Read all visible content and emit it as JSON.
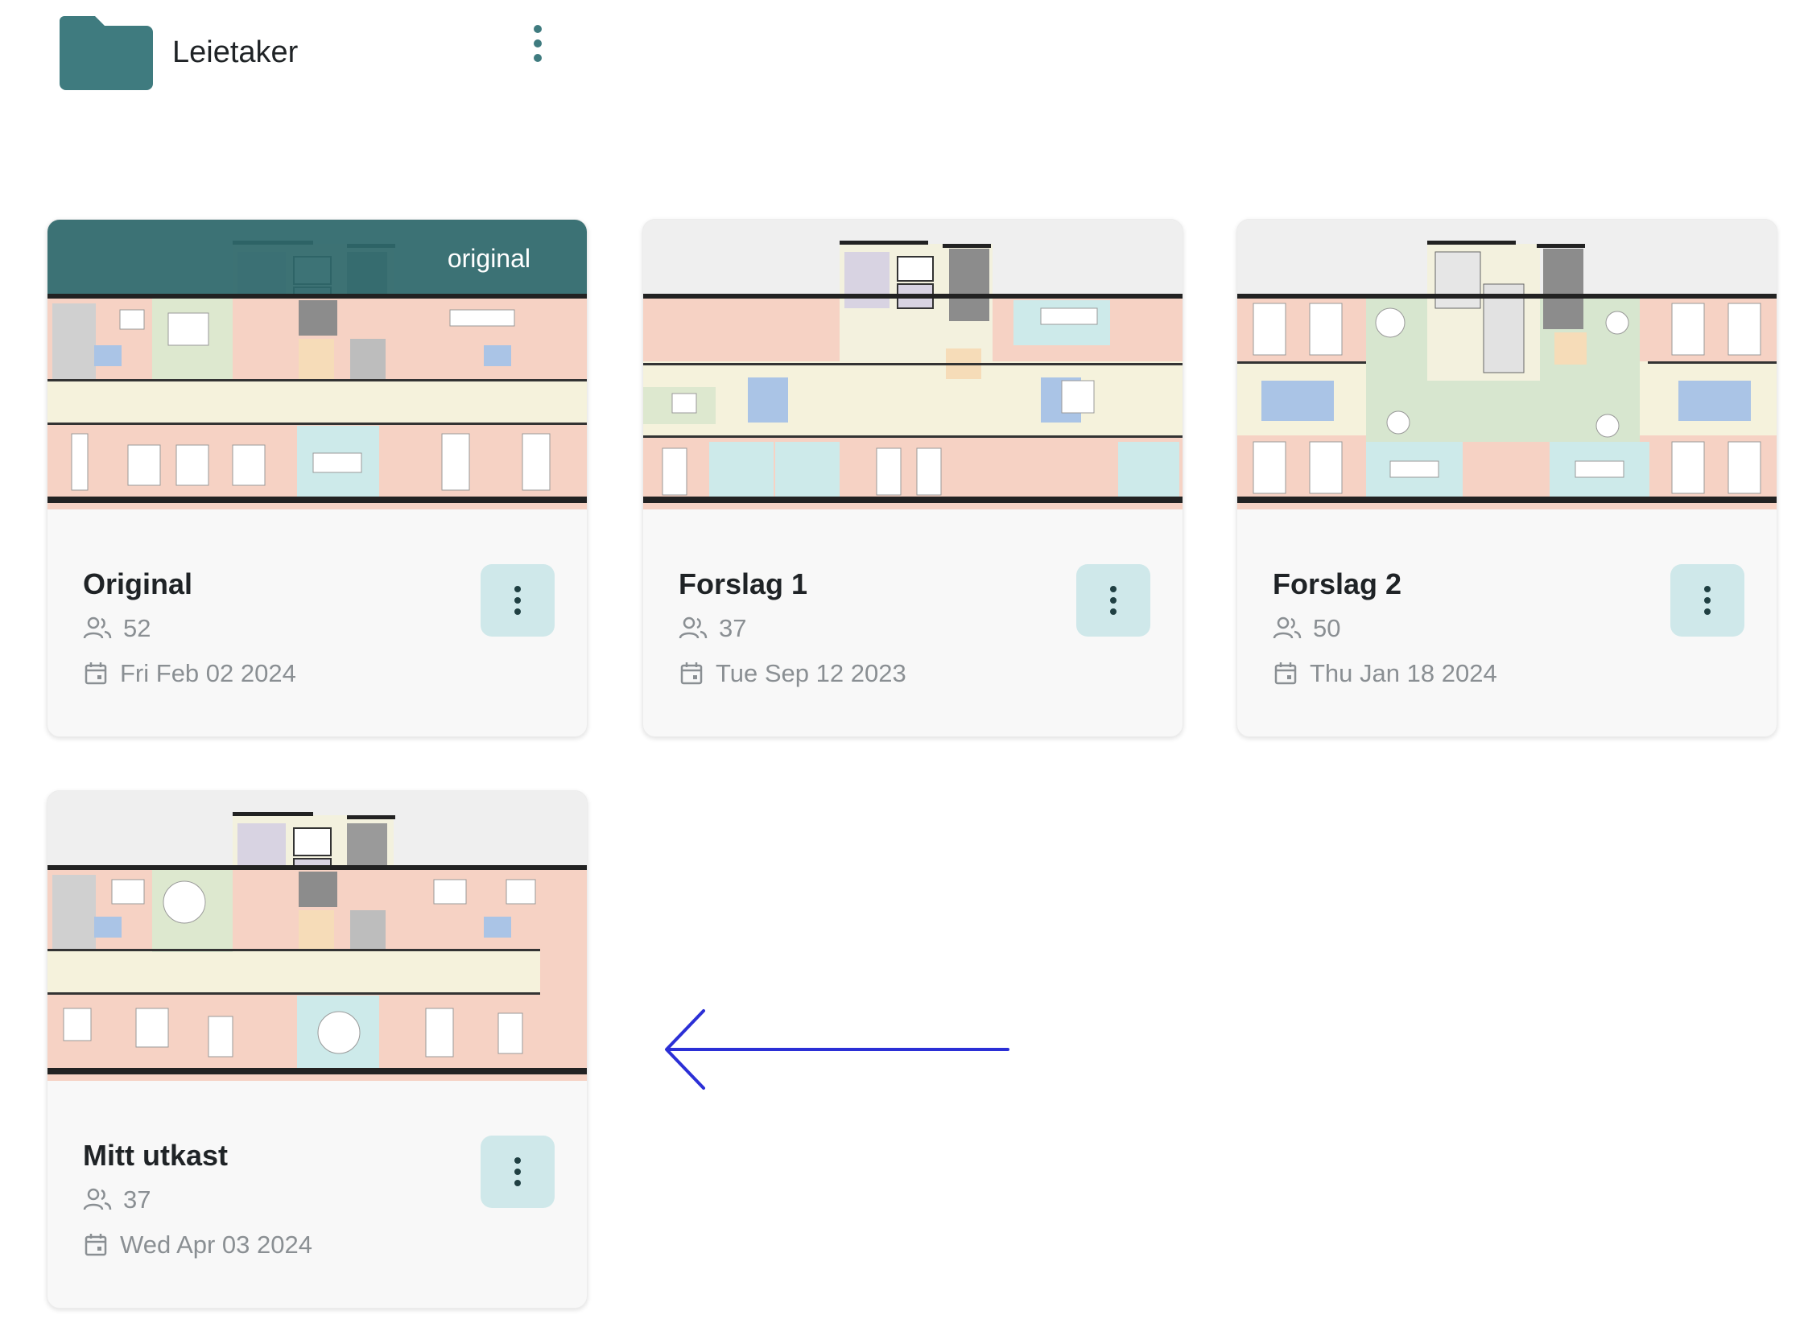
{
  "folder": {
    "name": "Leietaker",
    "icon": "folder-icon",
    "color": "#3f7b7f"
  },
  "colors": {
    "accent": "#3f7b7f",
    "menu_button_bg": "#cfe8ea",
    "original_badge_bg": "#2e686c",
    "arrow": "#2b2fd6"
  },
  "cards": [
    {
      "title": "Original",
      "people": "52",
      "date": "Fri Feb 02 2024",
      "badge": "original"
    },
    {
      "title": "Forslag 1",
      "people": "37",
      "date": "Tue Sep 12 2023"
    },
    {
      "title": "Forslag 2",
      "people": "50",
      "date": "Thu Jan 18 2024"
    },
    {
      "title": "Mitt utkast",
      "people": "37",
      "date": "Wed Apr 03 2024"
    }
  ],
  "icons": {
    "people": "people-icon",
    "date": "calendar-icon",
    "menu": "more-vertical-icon",
    "annotation": "arrow-left-icon"
  }
}
